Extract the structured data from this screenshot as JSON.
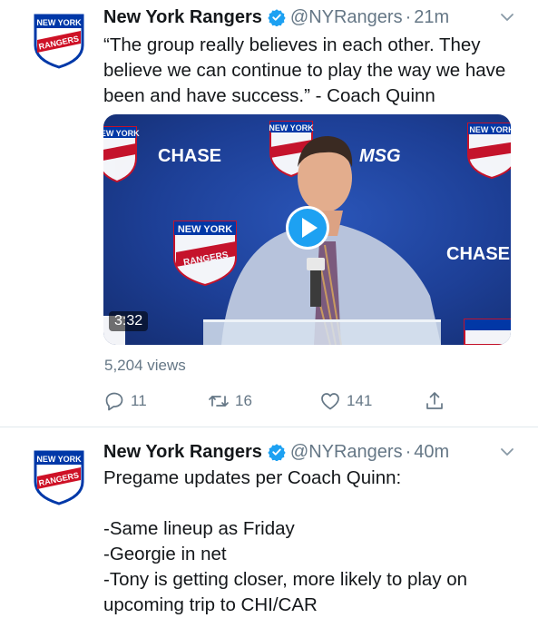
{
  "tweets": [
    {
      "name": "New York Rangers",
      "handle": "@NYRangers",
      "separator": "·",
      "time": "21m",
      "text": "“The group really believes in each other. They believe we can continue to play the way we have been and have success.” - Coach Quinn",
      "video": {
        "duration": "3:32",
        "views": "5,204 views",
        "backdrop_logo_text": [
          "NEW YORK",
          "RANGERS"
        ],
        "sponsor_text": [
          "CHASE",
          "MSG"
        ]
      },
      "actions": {
        "replies": "11",
        "retweets": "16",
        "likes": "141"
      }
    },
    {
      "name": "New York Rangers",
      "handle": "@NYRangers",
      "separator": "·",
      "time": "40m",
      "text": "Pregame updates per Coach Quinn:\n\n-Same lineup as Friday\n-Georgie in net\n-Tony is getting closer, more likely to play on upcoming trip to CHI/CAR"
    }
  ],
  "colors": {
    "accent": "#1da1f2",
    "muted": "#657786",
    "text": "#14171a",
    "rangers_blue": "#0038a8",
    "rangers_red": "#ce1126"
  },
  "icons": {
    "verified": "verified-badge-icon",
    "caret": "chevron-down-icon",
    "reply": "reply-icon",
    "retweet": "retweet-icon",
    "like": "heart-icon",
    "share": "share-icon",
    "play": "play-icon"
  }
}
